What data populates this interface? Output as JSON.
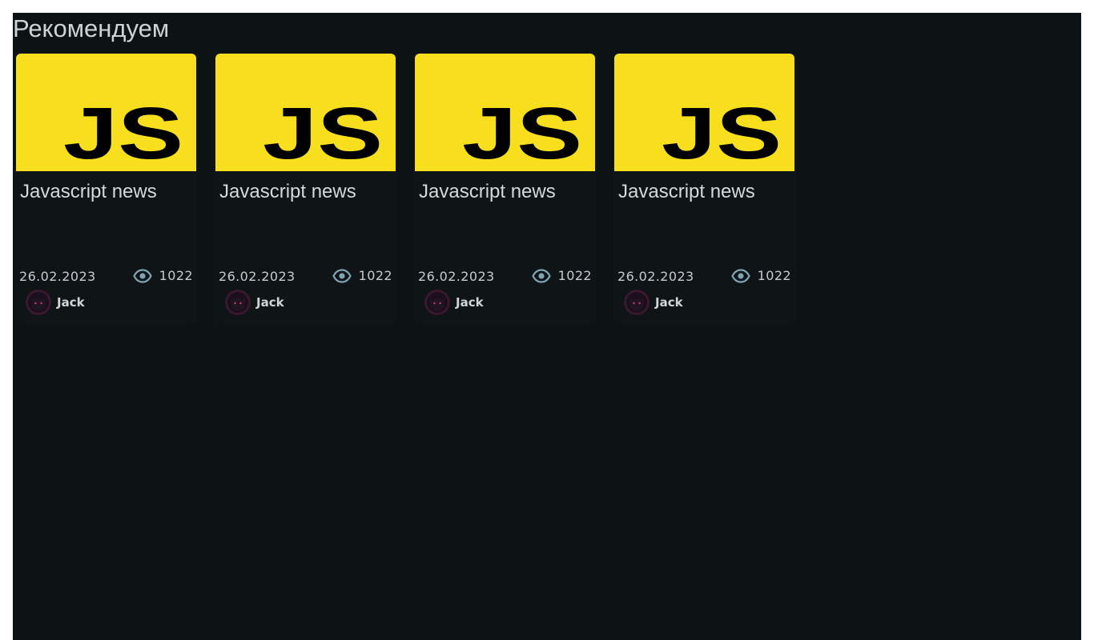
{
  "section": {
    "title": "Рекомендуем"
  },
  "cards": [
    {
      "thumb_text": "JS",
      "title": "Javascript news",
      "date": "26.02.2023",
      "views": "1022",
      "author": "Jack"
    },
    {
      "thumb_text": "JS",
      "title": "Javascript news",
      "date": "26.02.2023",
      "views": "1022",
      "author": "Jack"
    },
    {
      "thumb_text": "JS",
      "title": "Javascript news",
      "date": "26.02.2023",
      "views": "1022",
      "author": "Jack"
    },
    {
      "thumb_text": "JS",
      "title": "Javascript news",
      "date": "26.02.2023",
      "views": "1022",
      "author": "Jack"
    }
  ],
  "icons": {
    "views": "eye-icon",
    "avatar": "cat-avatar"
  },
  "colors": {
    "background": "#0d1215",
    "card": "#0f1417",
    "js_yellow": "#f7df1e",
    "eye": "#7fa3b3"
  }
}
